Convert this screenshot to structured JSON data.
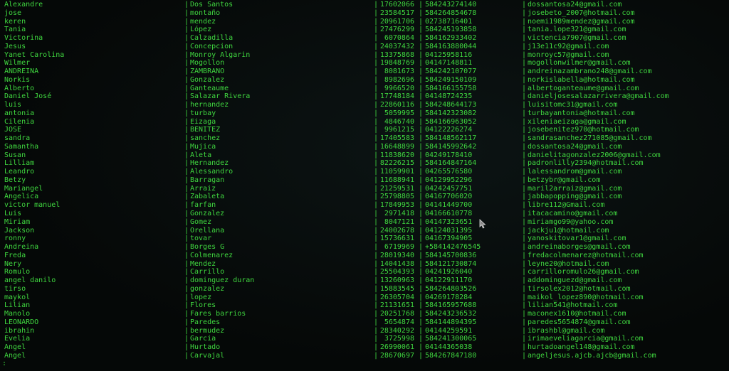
{
  "terminal": {
    "separator": "|",
    "prompt": ":",
    "text_color": "#3fd63f",
    "background": "#050807",
    "rows": [
      [
        "Alexandre",
        "Dos Santos",
        "17602066",
        "584243274140",
        "dossantosa24@gmail.com"
      ],
      [
        "jose",
        "montaño",
        "23584517",
        "584264854678",
        "josebeto_2007@hotmail.com"
      ],
      [
        "keren",
        "mendez",
        "20961706",
        "02738716401",
        "noemi1989mendez@gmail.com"
      ],
      [
        "Tania",
        "López",
        "27476299",
        "584245193858",
        "tania.lope321@gmail.com"
      ],
      [
        "Victorina",
        "Calzadilla",
        "6070864",
        "584162933402",
        "victencia7907@gmail.com"
      ],
      [
        "Jesus",
        "Concepcion",
        "24037432",
        "584163880044",
        "j13e11c92@gmail.com"
      ],
      [
        "Yanet Carolina",
        "Monroy Algarin",
        "13375868",
        "04125958116",
        "monroyc57@gmail.com"
      ],
      [
        "Wilmer",
        "Mogollon",
        "19848769",
        "04147148811",
        "mogollonwilmer@gmail.com"
      ],
      [
        "ANDREINA",
        "ZAMBRANO",
        "8081673",
        "584242107077",
        "andreinazambrano248@gmail.com"
      ],
      [
        "Norkis",
        "Gonzalez",
        "8982696",
        "584249150109",
        "norkislabella@hotmail.com"
      ],
      [
        "Alberto",
        "Ganteaume",
        "9966520",
        "584166155758",
        "albertoganteaume@gmail.com"
      ],
      [
        "Daniel José",
        "Salazar Rivera",
        "17748184",
        "04148724235",
        "danieljosesalazarrivera@gmail.com"
      ],
      [
        "luis",
        "hernandez",
        "22860116",
        "584248644173",
        "luisitomc31@gmail.com"
      ],
      [
        "antonia",
        "turbay",
        "5059995",
        "584142323082",
        "turbayantonia@hotmail.com"
      ],
      [
        "Cilenia",
        "Eizaga",
        "4846740",
        "584166963052",
        "xileniaeizaga@gmail.com"
      ],
      [
        "JOSE",
        "BENITEZ",
        "9961215",
        "04122226274",
        "josebenitez970@hotmail.com"
      ],
      [
        "sandra",
        "sanchez",
        "17405583",
        "584148562117",
        "sandrasanchez271085@gmail.com"
      ],
      [
        "Samantha",
        "Mujica",
        "16648899",
        "584145992642",
        "dossantosa24@gmail.com"
      ],
      [
        "Susan",
        "Aleta",
        "11838620",
        "04249178410",
        "danielitagonzalez2006@gmail.com"
      ],
      [
        "Lilliam",
        "Hernandez",
        "82226215",
        "584164847164",
        "padronlilly2394@hotmail.com"
      ],
      [
        "Leandro",
        "Alessandro",
        "11059901",
        "04265576580",
        "lalessandrom@gmail.com"
      ],
      [
        "Betzy",
        "Barragan",
        "11688941",
        "04129952296",
        "betzybr@gmail.com"
      ],
      [
        "Mariangel",
        "Arraiz",
        "21259531",
        "04242457751",
        "maril2arraiz@gmail.com"
      ],
      [
        "Angelica",
        "Zabaleta",
        "25798805",
        "04167706020",
        "jabbapopping@gmail.com"
      ],
      [
        "victor manuel",
        "farfan",
        "17849953",
        "04141449700",
        "libre112@Gmail.com"
      ],
      [
        "Luis",
        "Gonzalez",
        "2971418",
        "04166610778",
        "itacacamino@gmail.com"
      ],
      [
        "Miriam",
        "Gomez",
        "8047121",
        "04147323651",
        "miriamgo99@yahoo.com"
      ],
      [
        "Jackson",
        "Orellana",
        "24002678",
        "04124031395",
        "jackju1@hotmail.com"
      ],
      [
        "ronny",
        "tovar",
        "15736631",
        "04167394905",
        "yanoskitovar1@gmail.com"
      ],
      [
        "Andreina",
        "Borges G",
        "6719969",
        "+584142476545",
        "andreinaborges@gmail.com"
      ],
      [
        "Freda",
        "Colmenarez",
        "28019340",
        "584145700836",
        "fredacolmenarez@hotmail.com"
      ],
      [
        "Nery",
        "Mendez",
        "14041438",
        "584121730874",
        "leyne20@hotmail.com"
      ],
      [
        "Romulo",
        "Carrillo",
        "25504393",
        "04241926040",
        "carrilloromulo26@gmail.com"
      ],
      [
        "angel danilo",
        "dominguez duran",
        "13260963",
        "04122911170",
        "addominguezd@gmail.com"
      ],
      [
        "tirso",
        "gonzalez",
        "15883545",
        "584264803526",
        "tirsolex2012@hotmail.com"
      ],
      [
        "maykol",
        "lopez",
        "26305704",
        "04269178284",
        "maikol_lopez890@hotmail.com"
      ],
      [
        "Lilian",
        "Flores",
        "21131651",
        "584165957688",
        "lilian541@hotmail.com"
      ],
      [
        "Manolo",
        "Fares barrios",
        "20251768",
        "584243236532",
        "maconex1610@hotmail.com"
      ],
      [
        "LEONARDO",
        "Paredes",
        "5654874",
        "584144894395",
        "paredes5654874@gmail.com"
      ],
      [
        "ibrahin",
        "bermudez",
        "28340292",
        "04144259591",
        "ibrashbl@gmail.com"
      ],
      [
        "Evelia",
        "Garcia",
        "3725998",
        "584241300065",
        "irimaeveliagarcia@gmail.com"
      ],
      [
        "Angel",
        "Hurtado",
        "26990061",
        "04144365038",
        "hurtadoangel148@gmail.com"
      ],
      [
        "Angel",
        "Carvajal",
        "28670697",
        "584267847180",
        "angeljesus.ajcb.ajcb@gmail.com"
      ]
    ]
  }
}
